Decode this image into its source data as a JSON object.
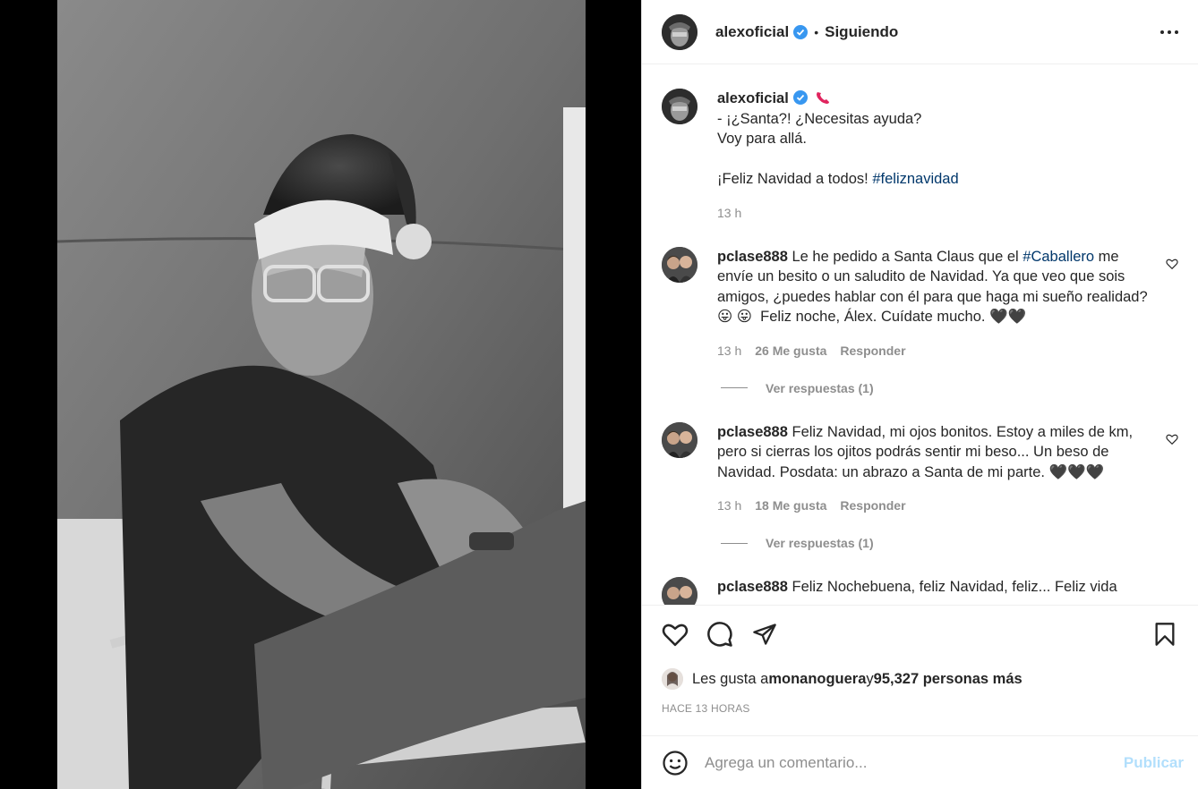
{
  "post": {
    "author": "alexoficial",
    "follow_status": "Siguiendo",
    "separator": "•",
    "caption_lines": [
      "- ¡¿Santa?! ¿Necesitas ayuda?",
      "Voy para allá.",
      "",
      "¡Feliz Navidad a todos! "
    ],
    "caption_hashtag": "#feliznavidad",
    "caption_time": "13 h"
  },
  "comments": [
    {
      "user": "pclase888",
      "text_before": " Le he pedido a Santa Claus que el ",
      "tag": "#Caballero",
      "text_after": " me envíe un besito o un saludito de Navidad. Ya que veo que sois amigos, ¿puedes hablar con él para que haga mi sueño realidad? 😛 😛  Feliz noche, Álex. Cuídate mucho. 🖤🖤",
      "time": "13 h",
      "likes": "26 Me gusta",
      "reply_label": "Responder",
      "view_replies": "Ver respuestas (1)"
    },
    {
      "user": "pclase888",
      "text_before": " Feliz Navidad, mi ojos bonitos. Estoy a miles de km, pero si cierras los ojitos podrás sentir mi beso... Un beso de Navidad. Posdata: un abrazo a Santa de mi parte. 🖤🖤🖤",
      "tag": "",
      "text_after": "",
      "time": "13 h",
      "likes": "18 Me gusta",
      "reply_label": "Responder",
      "view_replies": "Ver respuestas (1)"
    },
    {
      "user": "pclase888",
      "text_before": " Feliz Nochebuena, feliz Navidad, feliz... Feliz vida",
      "tag": "",
      "text_after": "",
      "time": "",
      "likes": "",
      "reply_label": "",
      "view_replies": ""
    }
  ],
  "likes_summary": {
    "prefix": "Les gusta a ",
    "user": "monanoguera",
    "middle": " y ",
    "count": "95,327 personas más"
  },
  "posted_ago": "HACE 13 HORAS",
  "add_comment": {
    "placeholder": "Agrega un comentario...",
    "publish_label": "Publicar"
  },
  "colors": {
    "verified": "#3897f0",
    "hashtag": "#00376b",
    "publish_disabled": "#b2dffc",
    "secondary_text": "#8e8e8e"
  },
  "icons": [
    "verified-badge-icon",
    "phone-icon",
    "more-options-icon",
    "heart-icon",
    "comment-icon",
    "share-icon",
    "bookmark-icon",
    "emoji-icon"
  ]
}
